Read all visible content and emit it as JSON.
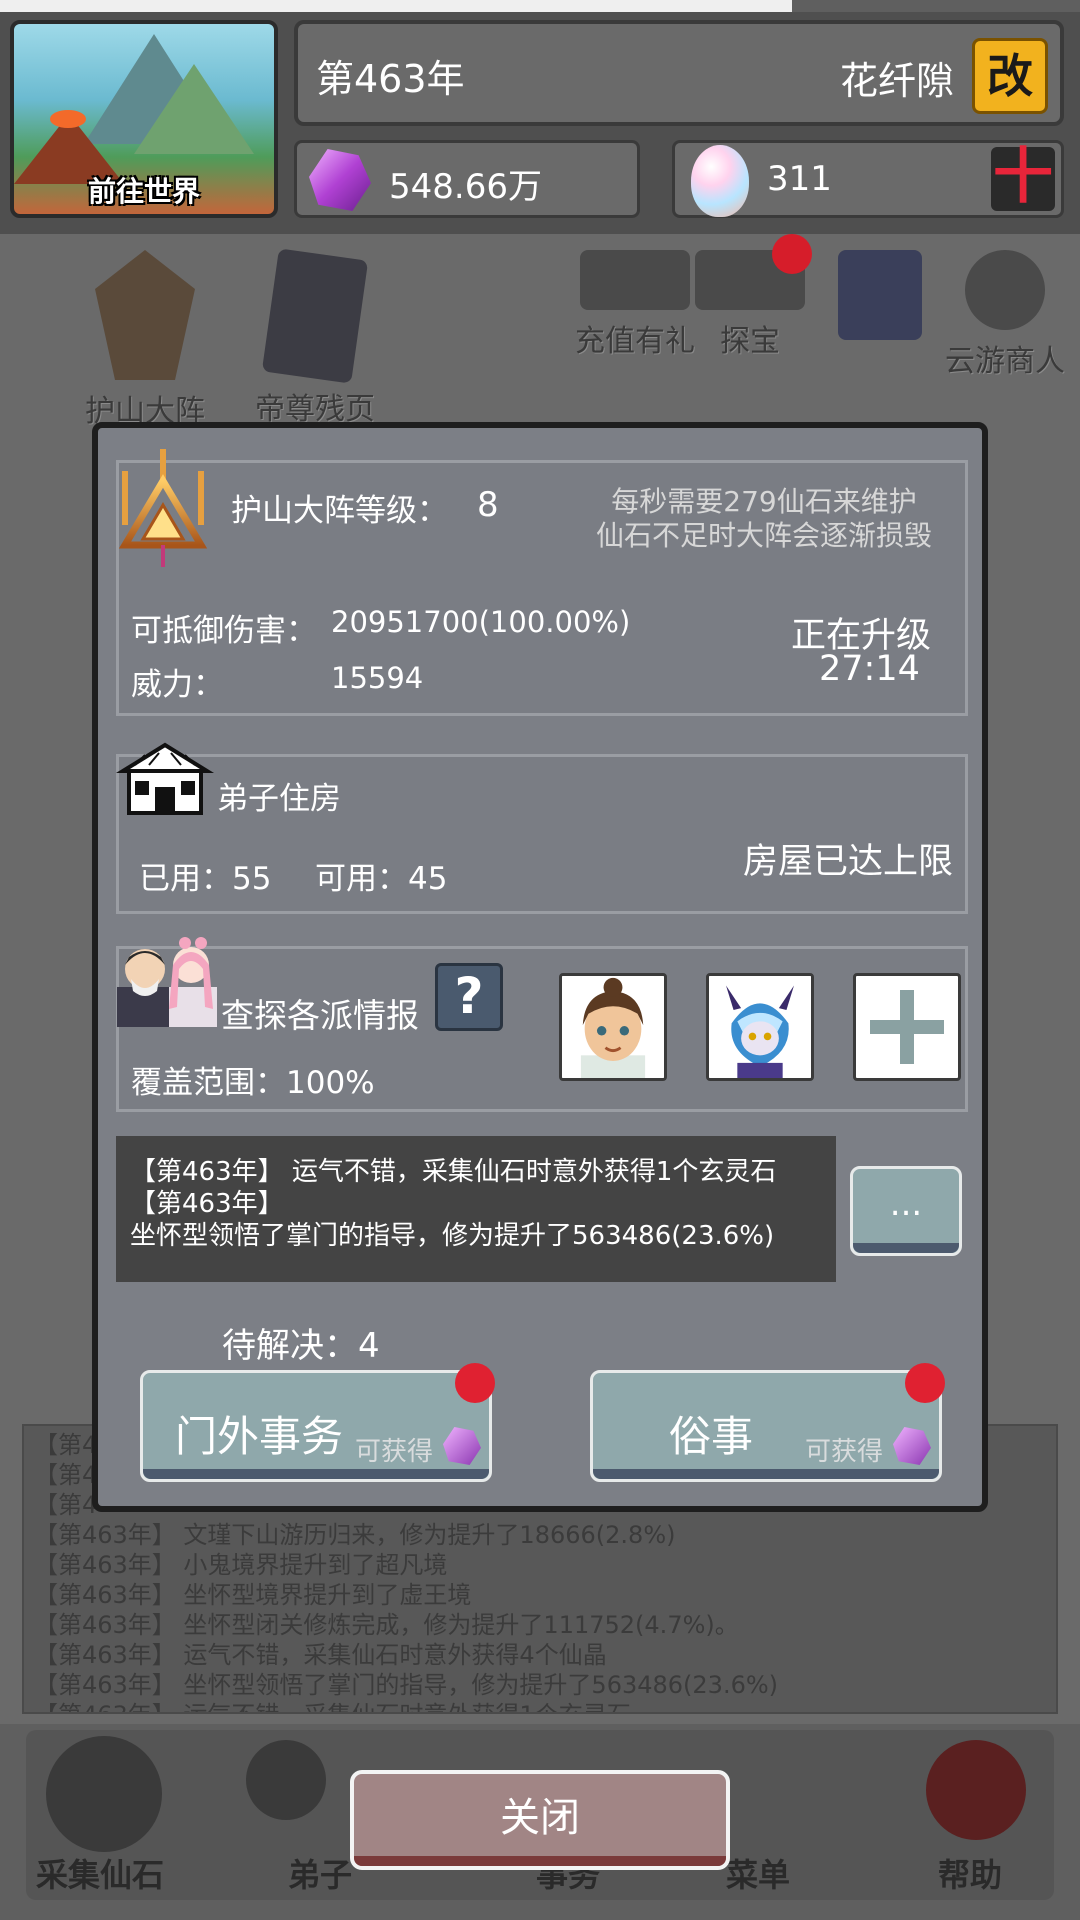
{
  "header": {
    "world_button": "前往世界",
    "year": "第463年",
    "player_name": "花纤隙",
    "rename_icon": "改",
    "stone_amount": "548.66万",
    "egg_amount": "311",
    "add_icon": "十"
  },
  "scene": {
    "items": [
      "护山大阵",
      "帝尊残页",
      "充值有礼",
      "探宝",
      "云游商人"
    ],
    "log_lines": [
      "【第4",
      "【第4",
      "【第4",
      "【第463年】 文瑾下山游历归来，修为提升了18666(2.8%)",
      "【第463年】 小鬼境界提升到了超凡境",
      "【第463年】 坐怀型境界提升到了虚王境",
      "【第463年】 坐怀型闭关修炼完成，修为提升了111752(4.7%)。",
      "【第463年】 运气不错，采集仙石时意外获得4个仙晶",
      "【第463年】 坐怀型领悟了掌门的指导，修为提升了563486(23.6%)",
      "【第463年】 运气不错，采集仙石时意外获得1个玄灵石"
    ],
    "nav": [
      "采集仙石",
      "弟子",
      "事务",
      "菜单",
      "帮助"
    ]
  },
  "modal": {
    "array": {
      "level_label": "护山大阵等级：",
      "level_value": "8",
      "note_line1": "每秒需要279仙石来维护",
      "note_line2": "仙石不足时大阵会逐渐损毁",
      "defense_label": "可抵御伤害：",
      "defense_value": "20951700(100.00%)",
      "power_label": "威力：",
      "power_value": "15594",
      "status": "正在升级",
      "timer": "27:14"
    },
    "housing": {
      "title": "弟子住房",
      "used": "已用：55",
      "available": "可用：45",
      "status": "房屋已达上限"
    },
    "intel": {
      "title": "查探各派情报",
      "help_icon": "?",
      "coverage": "覆盖范围：100%"
    },
    "log": {
      "line1": "【第463年】 运气不错，采集仙石时意外获得1个玄灵石",
      "line2": "【第463年】",
      "line3": "坐怀型领悟了掌门的指导，修为提升了563486(23.6%)",
      "more_label": "..."
    },
    "pending": "待解决：4",
    "buttons": {
      "outside": "门外事务",
      "outside_sub": "可获得",
      "secular": "俗事",
      "secular_sub": "可获得"
    }
  },
  "close_label": "关闭",
  "colors": {
    "accent_red": "#e02131",
    "rename_yellow": "#f2b21e",
    "button_teal": "#8fa8ab",
    "close_button": "#a18585"
  }
}
